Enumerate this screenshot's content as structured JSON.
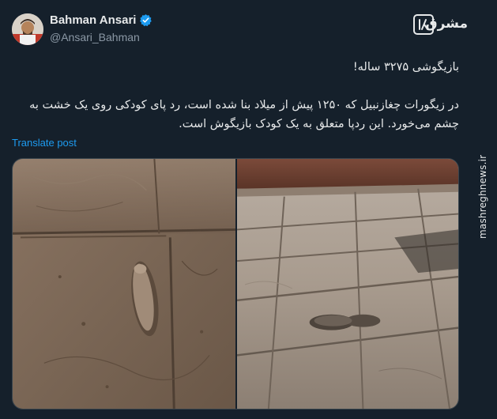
{
  "author": {
    "display_name": "Bahman Ansari",
    "handle": "@Ansari_Bahman",
    "verified": true
  },
  "brand": {
    "logo_text": "مشرق",
    "watermark": "mashreghnews.ir"
  },
  "post": {
    "line1": "بازیگوشی ۳۲۷۵ ساله!",
    "paragraph": "در زیگورات چغازنبیل که ۱۲۵۰ پیش از میلاد بنا شده است، رد پای کودکی روی یک خشت به چشم می‌خورد. این ردپا متعلق به یک کودک بازیگوش است.",
    "translate_label": "Translate post"
  },
  "colors": {
    "background": "#15202b",
    "link": "#1d9bf0",
    "verified": "#1d9bf0"
  },
  "media": {
    "count": 2
  }
}
